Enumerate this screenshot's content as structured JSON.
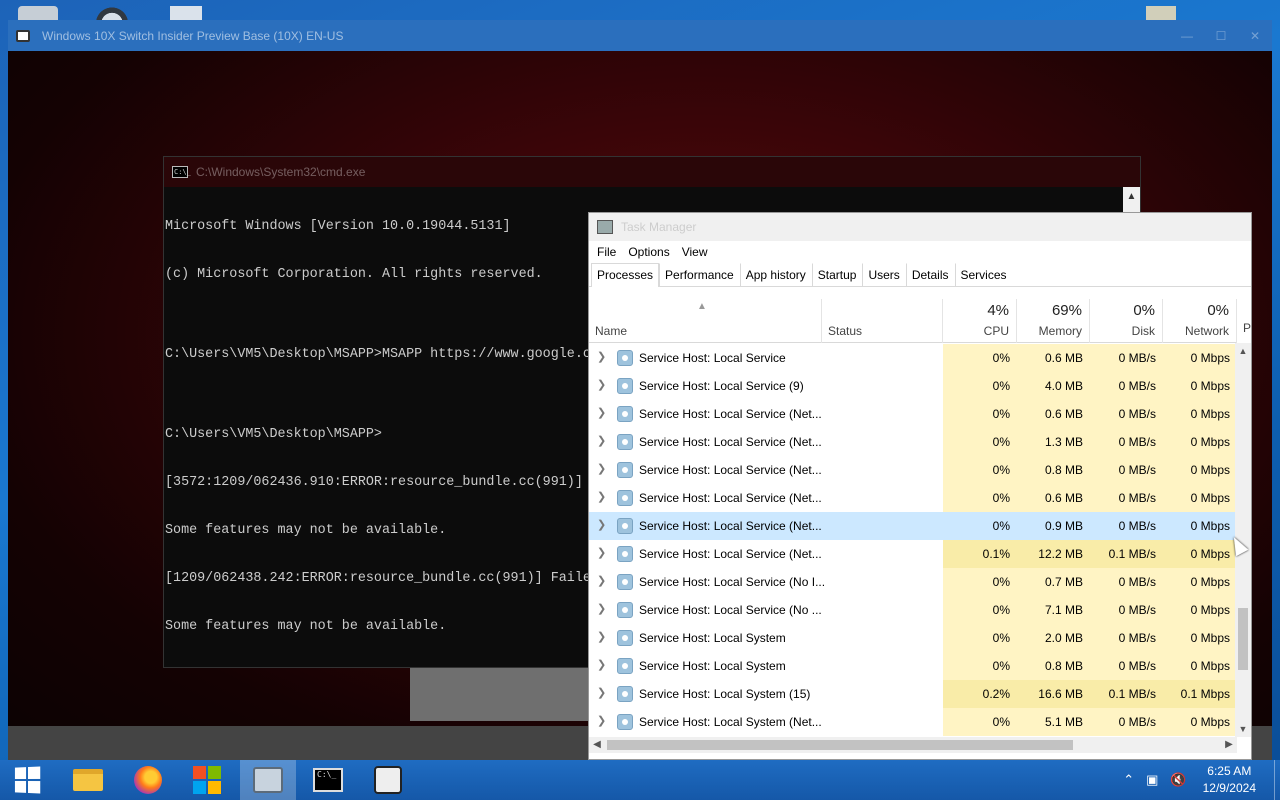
{
  "vm_window": {
    "title": "Windows 10X Switch Insider Preview Base (10X) EN-US"
  },
  "cmd": {
    "title": "C:\\Windows\\System32\\cmd.exe",
    "lines": [
      "Microsoft Windows [Version 10.0.19044.5131]",
      "(c) Microsoft Corporation. All rights reserved.",
      "",
      "C:\\Users\\VM5\\Desktop\\MSAPP>MSAPP https://www.google.c",
      "",
      "C:\\Users\\VM5\\Desktop\\MSAPP>",
      "[3572:1209/062436.910:ERROR:resource_bundle.cc(991)]",
      "Some features may not be available.",
      "[1209/062438.242:ERROR:resource_bundle.cc(991)] Faile",
      "Some features may not be available."
    ]
  },
  "task_manager": {
    "title": "Task Manager",
    "menu": [
      "File",
      "Options",
      "View"
    ],
    "tabs": [
      "Processes",
      "Performance",
      "App history",
      "Startup",
      "Users",
      "Details",
      "Services"
    ],
    "active_tab": "Processes",
    "columns": {
      "name": "Name",
      "status": "Status",
      "cpu": {
        "pct": "4%",
        "label": "CPU"
      },
      "memory": {
        "pct": "69%",
        "label": "Memory"
      },
      "disk": {
        "pct": "0%",
        "label": "Disk"
      },
      "network": {
        "pct": "0%",
        "label": "Network"
      },
      "extra": "P"
    },
    "rows": [
      {
        "name": "Service Host: Local Service",
        "cpu": "0%",
        "memory": "0.6 MB",
        "disk": "0 MB/s",
        "network": "0 Mbps"
      },
      {
        "name": "Service Host: Local Service (9)",
        "cpu": "0%",
        "memory": "4.0 MB",
        "disk": "0 MB/s",
        "network": "0 Mbps"
      },
      {
        "name": "Service Host: Local Service (Net...",
        "cpu": "0%",
        "memory": "0.6 MB",
        "disk": "0 MB/s",
        "network": "0 Mbps"
      },
      {
        "name": "Service Host: Local Service (Net...",
        "cpu": "0%",
        "memory": "1.3 MB",
        "disk": "0 MB/s",
        "network": "0 Mbps"
      },
      {
        "name": "Service Host: Local Service (Net...",
        "cpu": "0%",
        "memory": "0.8 MB",
        "disk": "0 MB/s",
        "network": "0 Mbps"
      },
      {
        "name": "Service Host: Local Service (Net...",
        "cpu": "0%",
        "memory": "0.6 MB",
        "disk": "0 MB/s",
        "network": "0 Mbps"
      },
      {
        "name": "Service Host: Local Service (Net...",
        "cpu": "0%",
        "memory": "0.9 MB",
        "disk": "0 MB/s",
        "network": "0 Mbps",
        "selected": true
      },
      {
        "name": "Service Host: Local Service (Net...",
        "cpu": "0.1%",
        "memory": "12.2 MB",
        "disk": "0.1 MB/s",
        "network": "0 Mbps"
      },
      {
        "name": "Service Host: Local Service (No I...",
        "cpu": "0%",
        "memory": "0.7 MB",
        "disk": "0 MB/s",
        "network": "0 Mbps"
      },
      {
        "name": "Service Host: Local Service (No ...",
        "cpu": "0%",
        "memory": "7.1 MB",
        "disk": "0 MB/s",
        "network": "0 Mbps"
      },
      {
        "name": "Service Host: Local System",
        "cpu": "0%",
        "memory": "2.0 MB",
        "disk": "0 MB/s",
        "network": "0 Mbps"
      },
      {
        "name": "Service Host: Local System",
        "cpu": "0%",
        "memory": "0.8 MB",
        "disk": "0 MB/s",
        "network": "0 Mbps"
      },
      {
        "name": "Service Host: Local System (15)",
        "cpu": "0.2%",
        "memory": "16.6 MB",
        "disk": "0.1 MB/s",
        "network": "0.1 Mbps"
      },
      {
        "name": "Service Host: Local System (Net...",
        "cpu": "0%",
        "memory": "5.1 MB",
        "disk": "0 MB/s",
        "network": "0 Mbps"
      }
    ]
  },
  "taskbar": {
    "time": "6:25 AM",
    "date": "12/9/2024",
    "apps": [
      "start",
      "file-explorer",
      "firefox",
      "windows-7",
      "virtual-machine",
      "command-prompt",
      "virtualbox"
    ]
  },
  "colors": {
    "heat_light": "#fff4c4",
    "heat_medium": "#f9eca8",
    "selection": "#cce8ff",
    "taskbar": "#1f6cc2"
  }
}
